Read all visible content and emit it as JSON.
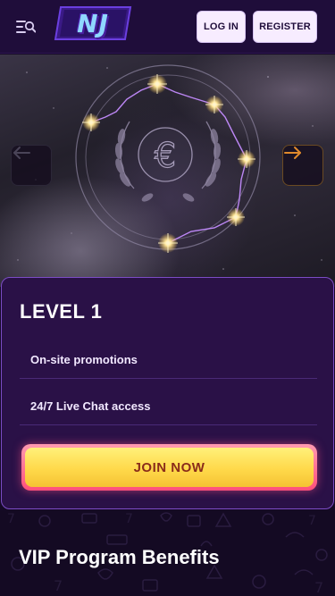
{
  "header": {
    "logo_text": "NJ",
    "login_label": "LOG IN",
    "register_label": "REGISTER"
  },
  "icons": {
    "menu": "menu-search-icon",
    "prev": "arrow-left-icon",
    "next": "arrow-right-icon",
    "hero_emblem": "euro-laurel-icon"
  },
  "hero": {
    "emblem_symbol": "€"
  },
  "level": {
    "title": "LEVEL 1",
    "perks": [
      "On-site promotions",
      "24/7 Live Chat access"
    ],
    "join_label": "JOIN NOW"
  },
  "benefits": {
    "title": "VIP Program Benefits"
  },
  "colors": {
    "header_bg": "#1f0d3a",
    "card_bg": "#2a1147",
    "card_border": "#7b4cc4",
    "join_text": "#8a2c1a",
    "join_yellow": "#ffd94a",
    "join_pink": "#ff4f7b"
  }
}
